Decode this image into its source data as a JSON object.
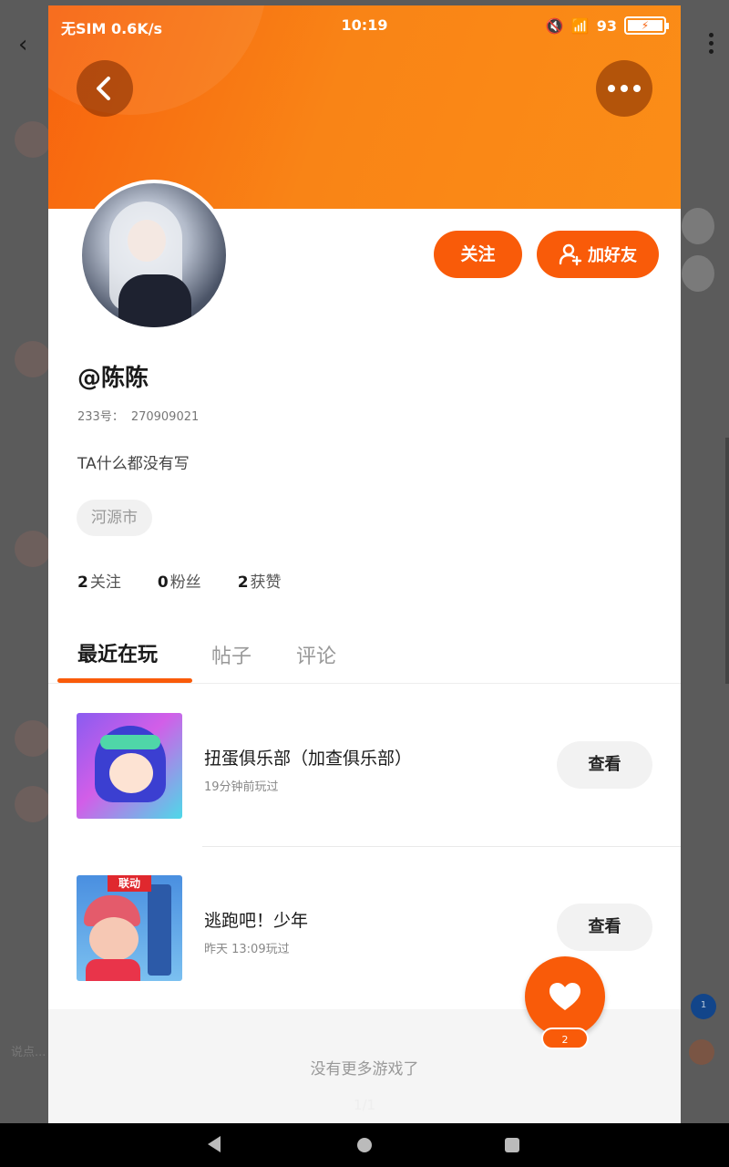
{
  "background": {
    "input_placeholder": "说点...",
    "badge_count": "1"
  },
  "status_bar": {
    "carrier": "无SIM 0.6K/s",
    "time": "10:19",
    "battery": "93"
  },
  "profile": {
    "username": "@陈陈",
    "id_label": "233号：",
    "id_value": "270909021",
    "bio": "TA什么都没有写",
    "location": "河源市",
    "follow_label": "关注",
    "add_friend_label": "加好友",
    "stats": [
      {
        "count": "2",
        "label": "关注"
      },
      {
        "count": "0",
        "label": "粉丝"
      },
      {
        "count": "2",
        "label": "获赞"
      }
    ]
  },
  "tabs": [
    {
      "label": "最近在玩",
      "active": true
    },
    {
      "label": "帖子",
      "active": false
    },
    {
      "label": "评论",
      "active": false
    }
  ],
  "games": [
    {
      "title": "扭蛋俱乐部（加查俱乐部）",
      "meta": "19分钟前玩过",
      "action": "查看"
    },
    {
      "title": "逃跑吧！少年",
      "meta": "昨天 13:09玩过",
      "action": "查看",
      "tag": "联动"
    }
  ],
  "footer": {
    "no_more": "没有更多游戏了",
    "page": "1/1"
  },
  "like_fab": {
    "count": "2"
  },
  "colors": {
    "accent": "#f95b09",
    "header_gradient_start": "#f7630e",
    "header_gradient_end": "#fb8d17"
  }
}
